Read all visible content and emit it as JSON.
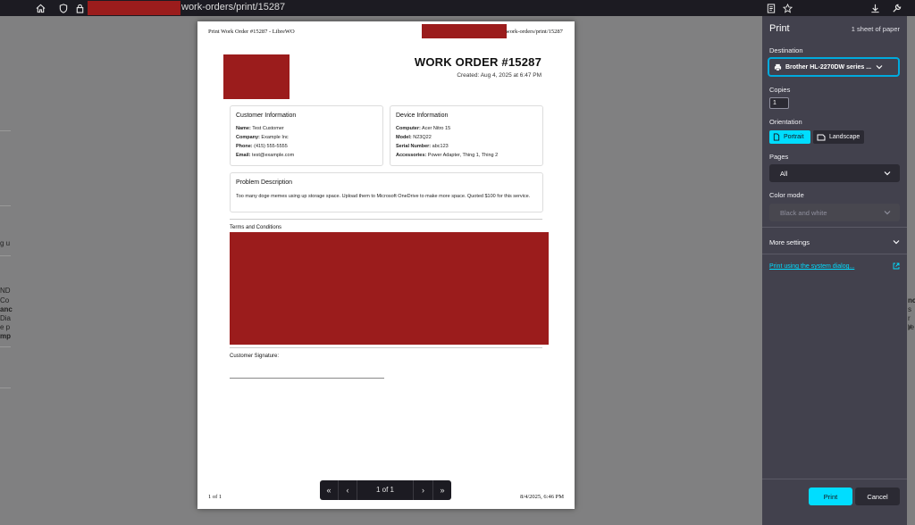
{
  "browser": {
    "url_suffix": "work-orders/print/15287"
  },
  "background_fragments": {
    "left": [
      "g u",
      "ND",
      "Co",
      "anc",
      "Dia",
      "e p",
      "mp"
    ],
    "right": [
      "nc",
      "s ",
      "r y",
      "re"
    ]
  },
  "document": {
    "header_left": "Print Work Order #15287 - LibreWO",
    "header_right": "work-orders/print/15287",
    "title": "WORK ORDER #15287",
    "created": "Created: Aug 4, 2025 at 6:47 PM",
    "customer": {
      "heading": "Customer Information",
      "name_label": "Name:",
      "name": "Test Customer",
      "company_label": "Company:",
      "company": "Example Inc",
      "phone_label": "Phone:",
      "phone": "(415) 555-5555",
      "email_label": "Email:",
      "email": "test@example.com"
    },
    "device": {
      "heading": "Device Information",
      "computer_label": "Computer:",
      "computer": "Acer Nitro 15",
      "model_label": "Model:",
      "model": "N23Q22",
      "serial_label": "Serial Number:",
      "serial": "abc123",
      "accessories_label": "Accessories:",
      "accessories": "Power Adapter, Thing 1, Thing 2"
    },
    "problem": {
      "heading": "Problem Description",
      "text": "Too many doge memes using up storage space. Upload them to Microsoft OneDrive to make more space. Quoted $100 for this service."
    },
    "terms_title": "Terms and Conditions",
    "signature_label": "Customer Signature:",
    "footer_left": "1 of 1",
    "footer_right": "8/4/2025, 6:46 PM"
  },
  "pager": {
    "label": "1 of 1",
    "first": "«",
    "prev": "‹",
    "next": "›",
    "last": "»"
  },
  "print_panel": {
    "title": "Print",
    "sheets": "1 sheet of paper",
    "destination_label": "Destination",
    "destination_value": "Brother HL-2270DW series ...",
    "copies_label": "Copies",
    "copies_value": "1",
    "orientation_label": "Orientation",
    "portrait": "Portrait",
    "landscape": "Landscape",
    "pages_label": "Pages",
    "pages_value": "All",
    "color_label": "Color mode",
    "color_value": "Black and white",
    "more_settings": "More settings",
    "system_dialog": "Print using the system dialog...",
    "print_button": "Print",
    "cancel_button": "Cancel",
    "accent": "#00ddff"
  }
}
